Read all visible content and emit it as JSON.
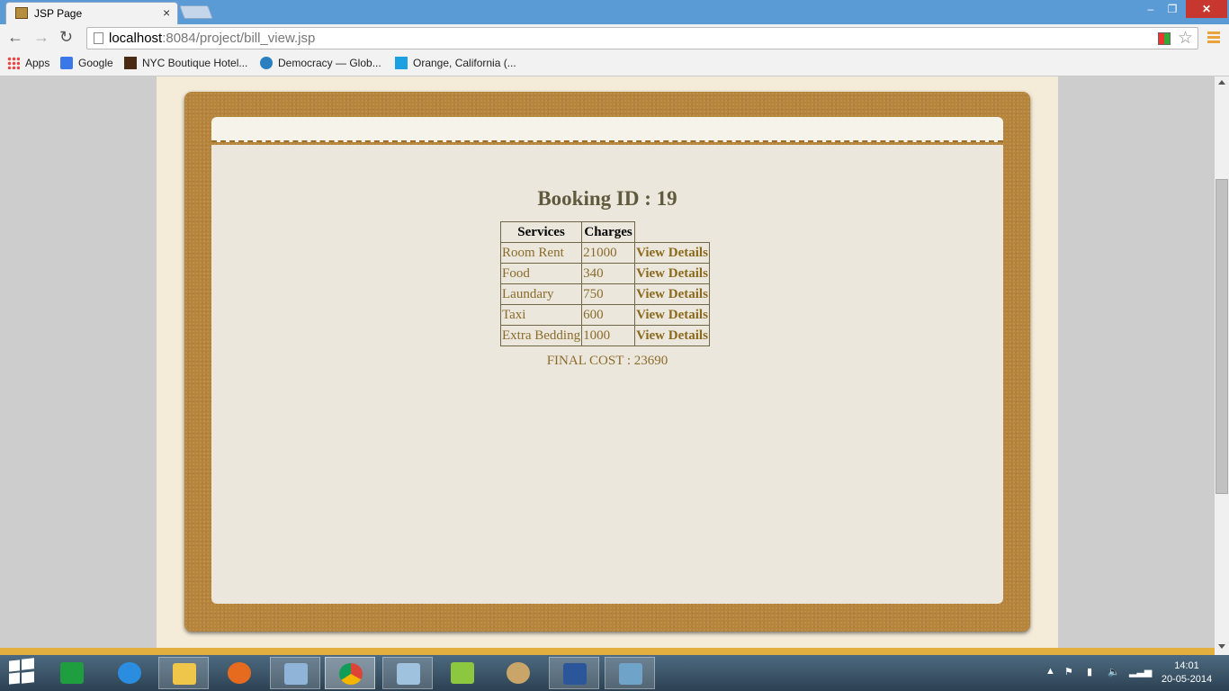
{
  "browser": {
    "tab_title": "JSP Page",
    "tab_close": "×",
    "window_controls": {
      "minimize": "–",
      "restore": "❐",
      "close": "✕"
    },
    "nav": {
      "back": "←",
      "forward": "→",
      "reload": "↻"
    },
    "url_host": "localhost",
    "url_rest": ":8084/project/bill_view.jsp",
    "bookmark_star": "☆",
    "bookmarks": [
      {
        "label": "Apps",
        "icon": "apps-grid-icon"
      },
      {
        "label": "Google",
        "icon": "google-icon"
      },
      {
        "label": "NYC Boutique Hotel...",
        "icon": "hc-icon"
      },
      {
        "label": "Democracy — Glob...",
        "icon": "globe-icon"
      },
      {
        "label": "Orange, California (...",
        "icon": "f-icon"
      }
    ]
  },
  "page": {
    "booking_title": "Booking ID : 19",
    "table": {
      "headers": [
        "Services",
        "Charges"
      ],
      "rows": [
        {
          "service": "Room Rent",
          "charge": "21000",
          "action": "View Details"
        },
        {
          "service": "Food",
          "charge": "340",
          "action": "View Details"
        },
        {
          "service": "Laundary",
          "charge": "750",
          "action": "View Details"
        },
        {
          "service": "Taxi",
          "charge": "600",
          "action": "View Details"
        },
        {
          "service": "Extra Bedding",
          "charge": "1000",
          "action": "View Details"
        }
      ]
    },
    "final_cost": "FINAL COST : 23690"
  },
  "taskbar": {
    "apps": [
      "file-explorer",
      "store",
      "internet-explorer",
      "explorer-folder",
      "firefox",
      "virtualbox",
      "chrome",
      "remote-desktop",
      "notepad-plus",
      "paint",
      "word",
      "photos"
    ],
    "time": "14:01",
    "date": "20-05-2014"
  },
  "colors": {
    "title_bar": "#5b9bd5",
    "frame": "#b5853d",
    "panel": "#ebe7dc",
    "text_brown": "#8a6b2b",
    "heading": "#5f5a3e"
  }
}
